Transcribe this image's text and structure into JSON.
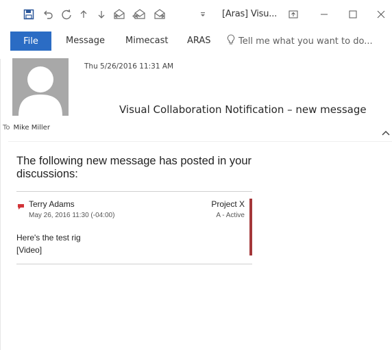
{
  "window": {
    "title": "[Aras] Visu...",
    "controls": [
      "restore-ribbon-icon",
      "minimize-icon",
      "maximize-icon",
      "close-icon"
    ]
  },
  "quick_access": [
    "save-icon",
    "undo-icon",
    "redo-icon",
    "previous-item-icon",
    "next-item-icon",
    "reply-icon",
    "reply-all-icon",
    "forward-icon",
    "customize-toolbar-icon"
  ],
  "ribbon": {
    "file_label": "File",
    "tabs": [
      "Message",
      "Mimecast",
      "ARAS"
    ],
    "tell_me_placeholder": "Tell me what you want to do..."
  },
  "header": {
    "date": "Thu 5/26/2016 11:31 AM",
    "subject": "Visual Collaboration Notification – new message",
    "to_label": "To",
    "recipient": "Mike Miller"
  },
  "message": {
    "intro": "The following new message has posted in your discussions:",
    "post": {
      "author": "Terry Adams",
      "timestamp": "May 26, 2016 11:30 (-04:00)",
      "project": "Project X",
      "state": "A - Active",
      "text_line1": "Here's the test rig",
      "text_line2": "[Video]"
    }
  },
  "colors": {
    "accent": "#2b6cc4",
    "post_bar": "#a4373a",
    "flag": "#d13438"
  }
}
